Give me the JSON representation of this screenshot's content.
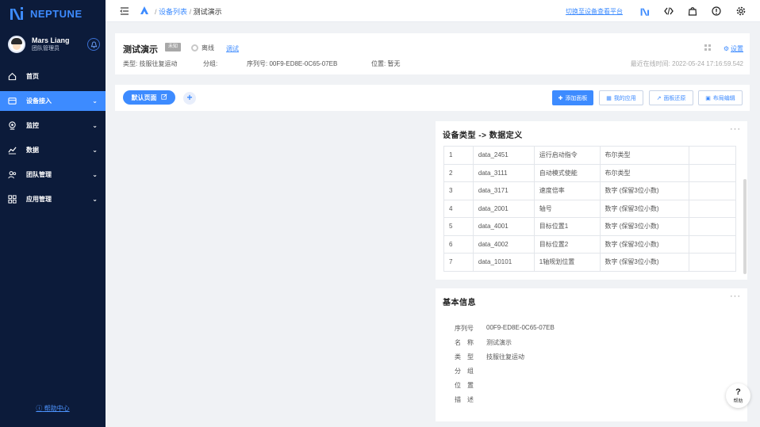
{
  "sidebar": {
    "logo_text": "NEPTUNE",
    "user": {
      "name": "Mars Liang",
      "role": "团队管理员"
    },
    "nav": [
      {
        "label": "首页",
        "icon": "home-icon"
      },
      {
        "label": "设备接入",
        "icon": "device-icon"
      },
      {
        "label": "监控",
        "icon": "monitor-icon"
      },
      {
        "label": "数据",
        "icon": "chart-icon"
      },
      {
        "label": "团队管理",
        "icon": "team-icon"
      },
      {
        "label": "应用管理",
        "icon": "apps-icon"
      }
    ],
    "help_center": "帮助中心"
  },
  "topbar": {
    "breadcrumb_link": "设备列表",
    "breadcrumb_sep": "/",
    "breadcrumb_current": "测试演示",
    "switch_link": "切换至设备查看平台"
  },
  "device": {
    "title": "测试演示",
    "tag": "未知",
    "status": "离线",
    "test_link": "调试",
    "type_label": "类型:",
    "type_value": "技服往复运动",
    "group_label": "分组:",
    "group_value": "",
    "serial_label": "序列号:",
    "serial_value": "00F9-ED8E-0C65-07EB",
    "location_label": "位置:",
    "location_value": "暂无",
    "last_online": "最近在线时间: 2022-05-24 17:16:59.542",
    "settings": "设置"
  },
  "toolbar": {
    "default_page": "默认页面",
    "add_panel": "添加面板",
    "my_apps": "我的应用",
    "restore_panel": "面板还原",
    "layout_edit": "布局编辑"
  },
  "data_def_panel": {
    "title": "设备类型 -> 数据定义",
    "more": "···",
    "rows": [
      [
        "1",
        "data_2451",
        "运行启动指令",
        "布尔类型",
        ""
      ],
      [
        "2",
        "data_3111",
        "自动模式使能",
        "布尔类型",
        ""
      ],
      [
        "3",
        "data_3171",
        "速度倍率",
        "数字 (保留3位小数)",
        ""
      ],
      [
        "4",
        "data_2001",
        "轴号",
        "数字 (保留3位小数)",
        ""
      ],
      [
        "5",
        "data_4001",
        "目标位置1",
        "数字 (保留3位小数)",
        ""
      ],
      [
        "6",
        "data_4002",
        "目标位置2",
        "数字 (保留3位小数)",
        ""
      ],
      [
        "7",
        "data_10101",
        "1轴规划位置",
        "数字 (保留3位小数)",
        ""
      ]
    ]
  },
  "basic_info_panel": {
    "title": "基本信息",
    "more": "···",
    "rows": [
      {
        "label": "序列号",
        "value": "00F9-ED8E-0C65-07EB"
      },
      {
        "label": "名　称",
        "value": "测试演示"
      },
      {
        "label": "类　型",
        "value": "技服往复运动"
      },
      {
        "label": "分　组",
        "value": ""
      },
      {
        "label": "位　置",
        "value": ""
      },
      {
        "label": "描　述",
        "value": ""
      }
    ]
  },
  "help_fab": {
    "symbol": "?",
    "label": "帮助"
  }
}
